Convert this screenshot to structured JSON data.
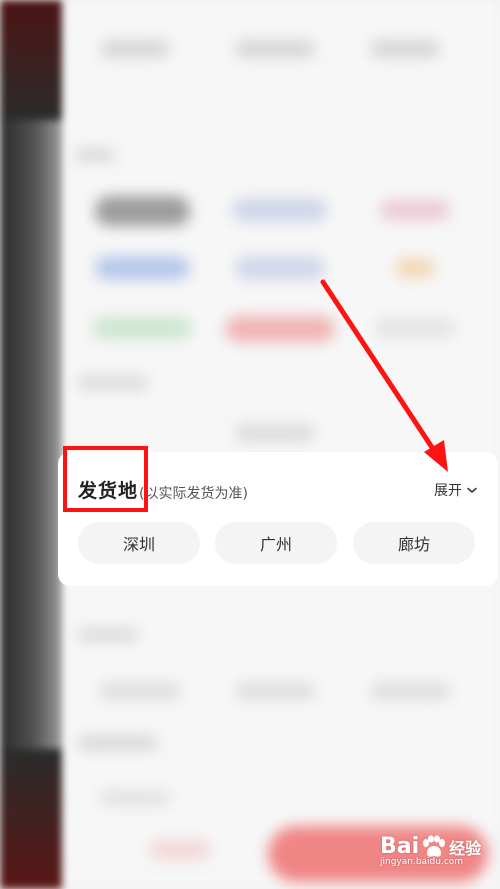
{
  "popup": {
    "title": "发货地",
    "subtitle": "(以实际发货为准)",
    "expand_label": "展开",
    "expand_icon": "chevron-down-icon",
    "chips": [
      "深圳",
      "广州",
      "廊坊"
    ]
  },
  "annotation": {
    "highlight_color": "#ff1212",
    "arrow_color": "#ff1212"
  },
  "watermark": {
    "brand_left": "Bai",
    "brand_right": "经验",
    "url": "jingyan.baidu.com"
  }
}
